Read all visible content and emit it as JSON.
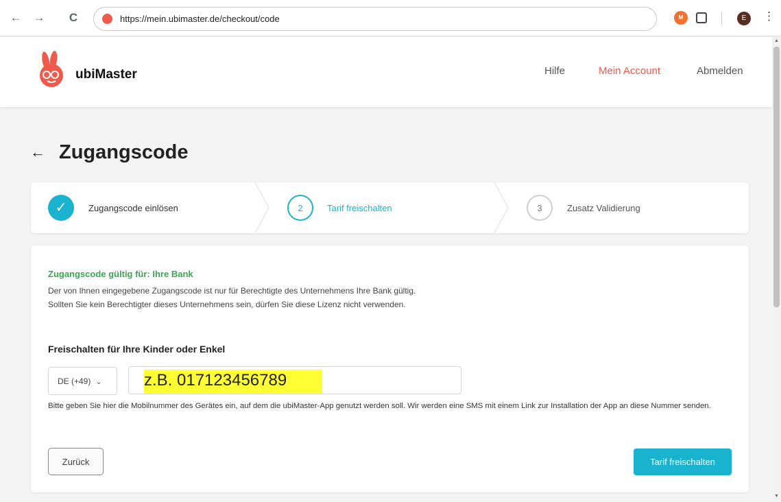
{
  "browser": {
    "url": "https://mein.ubimaster.de/checkout/code",
    "back_icon": "←",
    "forward_icon": "→",
    "reload_icon": "C",
    "extension_label": "M",
    "profile_initial": "E",
    "menu_icon": "⋮"
  },
  "header": {
    "brand": "ubiMaster",
    "nav": {
      "help": "Hilfe",
      "account": "Mein Account",
      "logout": "Abmelden"
    },
    "accent_color": "#ef5a4c"
  },
  "page": {
    "back_icon": "←",
    "title": "Zugangscode"
  },
  "stepper": {
    "steps": [
      {
        "number": "✓",
        "label": "Zugangscode einlösen",
        "state": "done"
      },
      {
        "number": "2",
        "label": "Tarif freischalten",
        "state": "active"
      },
      {
        "number": "3",
        "label": "Zusatz Validierung",
        "state": "pending"
      }
    ],
    "active_color": "#1ab3cf"
  },
  "card": {
    "valid_title": "Zugangscode gültig für: Ihre Bank",
    "valid_line1": "Der von Ihnen eingegebene Zugangscode ist nur für Berechtigte des Unternehmens Ihre Bank gültig.",
    "valid_line2": "Sollten Sie kein Berechtigter dieses Unternehmens sein, dürfen Sie diese Lizenz nicht verwenden.",
    "section_title": "Freischalten für Ihre Kinder oder Enkel",
    "country_code": "DE (+49)",
    "phone_placeholder": "z.B. 017123456789",
    "hint": "Bitte geben Sie hier die Mobilnummer des Gerätes ein, auf dem die ubiMaster-App genutzt werden soll. Wir werden eine SMS mit einem Link zur Installation der App an diese Nummer senden.",
    "back_button": "Zurück",
    "submit_button": "Tarif freischalten",
    "valid_color": "#3aa655"
  }
}
